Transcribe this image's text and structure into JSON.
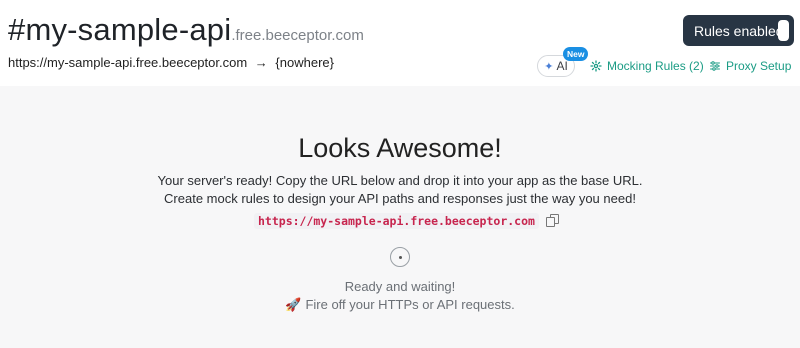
{
  "header": {
    "title": "#my-sample-api",
    "domain": ".free.beeceptor.com",
    "endpoint_url": "https://my-sample-api.free.beeceptor.com",
    "arrow": "→",
    "target": "{nowhere}"
  },
  "toggle": {
    "label": "Rules enabled",
    "enabled": true
  },
  "actions": {
    "ai_label": "AI",
    "ai_badge": "New",
    "mocking_rules": "Mocking Rules (2)",
    "proxy_setup": "Proxy Setup"
  },
  "hero": {
    "title": "Looks Awesome!",
    "line1": "Your server's ready! Copy the URL below and drop it into your app as the base URL.",
    "line2": "Create mock rules to design your API paths and responses just the way you need!",
    "url": "https://my-sample-api.free.beeceptor.com"
  },
  "status": {
    "line1": "Ready and waiting!",
    "line2": "Fire off your HTTPs or API requests."
  },
  "colors": {
    "accent": "#1b9c85",
    "toggle_bg": "#283544",
    "code_text": "#c7254e",
    "badge": "#1a8fe3"
  },
  "icons": [
    "sparkle-icon",
    "gear-icon",
    "sliders-icon",
    "copy-icon",
    "rocket-icon"
  ]
}
